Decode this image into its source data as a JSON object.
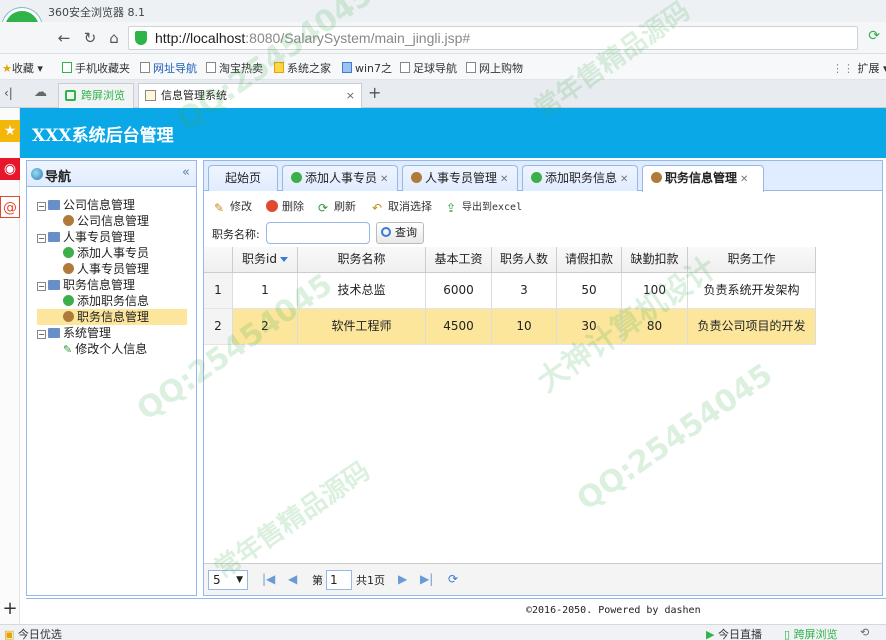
{
  "browser": {
    "title": "360安全浏览器 8.1",
    "url_host": "http://localhost",
    "url_path": ":8080/SalarySystem/main_jingli.jsp#",
    "bookmarks": [
      "收藏",
      "手机收藏夹",
      "网址导航",
      "淘宝热卖",
      "系统之家",
      "win7之",
      "足球导航",
      "网上购物",
      "扩展"
    ],
    "tabs": [
      "跨屏浏览",
      "信息管理系统"
    ]
  },
  "app": {
    "title": "XXX系统后台管理",
    "nav_title": "导航",
    "tree": [
      {
        "label": "公司信息管理",
        "level": 0
      },
      {
        "label": "公司信息管理",
        "level": 1
      },
      {
        "label": "人事专员管理",
        "level": 0
      },
      {
        "label": "添加人事专员",
        "level": 1
      },
      {
        "label": "人事专员管理",
        "level": 1
      },
      {
        "label": "职务信息管理",
        "level": 0
      },
      {
        "label": "添加职务信息",
        "level": 1
      },
      {
        "label": "职务信息管理",
        "level": 1
      },
      {
        "label": "系统管理",
        "level": 0
      },
      {
        "label": "修改个人信息",
        "level": 1
      }
    ],
    "content_tabs": [
      "起始页",
      "添加人事专员",
      "人事专员管理",
      "添加职务信息",
      "职务信息管理"
    ],
    "toolbar": {
      "edit": "修改",
      "delete": "删除",
      "refresh": "刷新",
      "cancel_select": "取消选择",
      "export": "导出到excel"
    },
    "search": {
      "label": "职务名称:",
      "button": "查询"
    },
    "grid": {
      "columns": [
        "职务id",
        "职务名称",
        "基本工资",
        "职务人数",
        "请假扣款",
        "缺勤扣款",
        "职务工作"
      ],
      "rows": [
        {
          "num": "1",
          "cells": [
            "1",
            "技术总监",
            "6000",
            "3",
            "50",
            "100",
            "负责系统开发架构"
          ]
        },
        {
          "num": "2",
          "cells": [
            "2",
            "软件工程师",
            "4500",
            "10",
            "30",
            "80",
            "负责公司项目的开发"
          ]
        }
      ]
    },
    "pager": {
      "page_size": "5",
      "page_prefix": "第",
      "page_value": "1",
      "page_total": "共1页"
    },
    "footer": "©2016-2050. Powered by dashen"
  },
  "status": {
    "left": "今日优选",
    "right1": "今日直播",
    "right2": "跨屏浏览"
  },
  "watermark": {
    "qq": "QQ:25454045",
    "slogan1": "常年售精品源码",
    "slogan2": "大神计算机设计"
  }
}
